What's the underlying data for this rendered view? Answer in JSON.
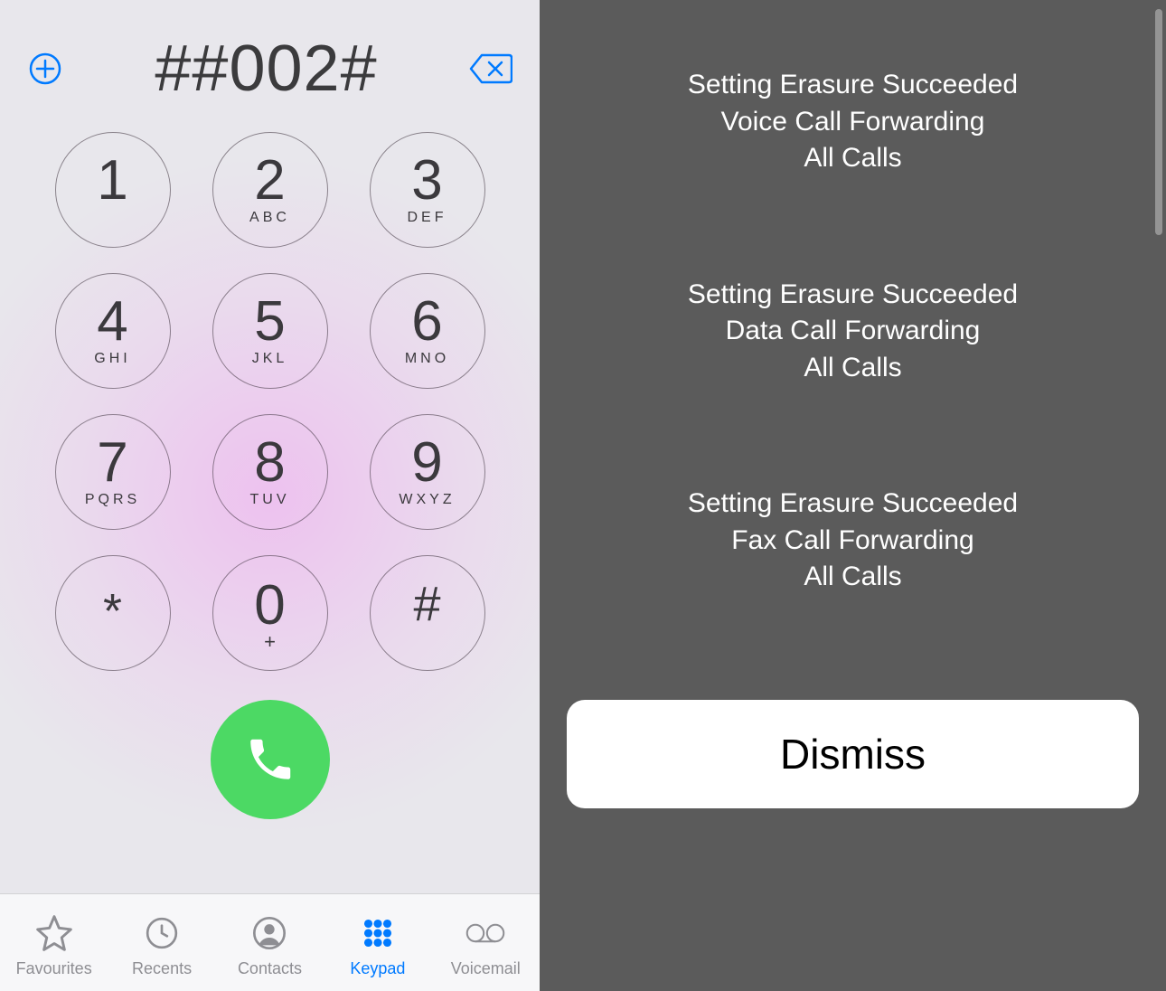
{
  "dialer": {
    "number": "##002#",
    "keys": [
      {
        "digit": "1",
        "letters": ""
      },
      {
        "digit": "2",
        "letters": "ABC"
      },
      {
        "digit": "3",
        "letters": "DEF"
      },
      {
        "digit": "4",
        "letters": "GHI"
      },
      {
        "digit": "5",
        "letters": "JKL"
      },
      {
        "digit": "6",
        "letters": "MNO"
      },
      {
        "digit": "7",
        "letters": "PQRS"
      },
      {
        "digit": "8",
        "letters": "TUV"
      },
      {
        "digit": "9",
        "letters": "WXYZ"
      },
      {
        "digit": "*",
        "letters": ""
      },
      {
        "digit": "0",
        "sub": "+"
      },
      {
        "digit": "#",
        "letters": ""
      }
    ],
    "tabs": {
      "favourites": "Favourites",
      "recents": "Recents",
      "contacts": "Contacts",
      "keypad": "Keypad",
      "voicemail": "Voicemail"
    },
    "icons": {
      "add": "plus-circle-icon",
      "delete": "backspace-icon",
      "call": "phone-icon",
      "favourites": "star-icon",
      "recents": "clock-icon",
      "contacts": "contact-silhouette-icon",
      "keypad": "keypad-dots-icon",
      "voicemail": "voicemail-icon"
    }
  },
  "result": {
    "messages": [
      {
        "l1": "Setting Erasure Succeeded",
        "l2": "Voice Call Forwarding",
        "l3": "All Calls"
      },
      {
        "l1": "Setting Erasure Succeeded",
        "l2": "Data Call Forwarding",
        "l3": "All Calls"
      },
      {
        "l1": "Setting Erasure Succeeded",
        "l2": "Fax Call Forwarding",
        "l3": "All Calls"
      }
    ],
    "dismiss": "Dismiss"
  }
}
